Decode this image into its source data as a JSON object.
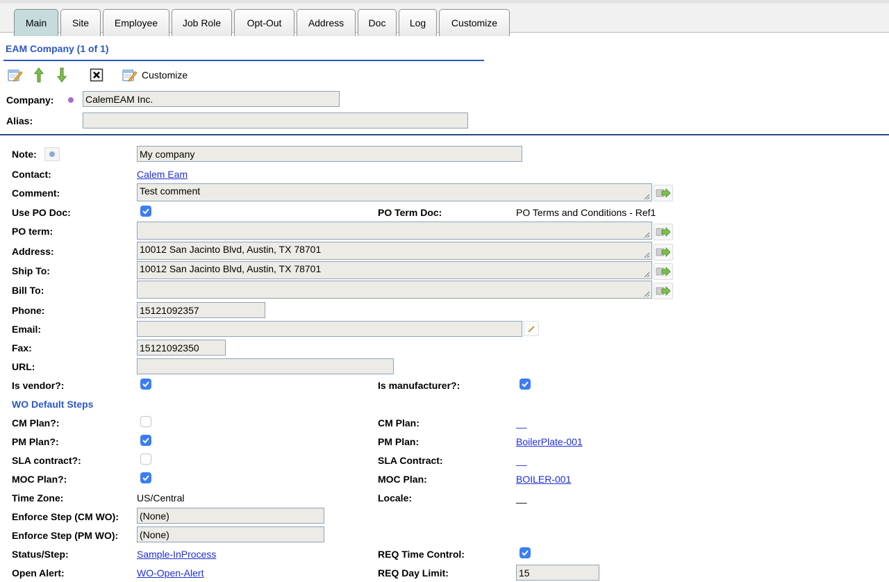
{
  "tabs": [
    {
      "label": "Main",
      "active": true
    },
    {
      "label": "Site"
    },
    {
      "label": "Employee"
    },
    {
      "label": "Job Role"
    },
    {
      "label": "Opt-Out"
    },
    {
      "label": "Address"
    },
    {
      "label": "Doc"
    },
    {
      "label": "Log"
    },
    {
      "label": "Customize"
    }
  ],
  "header": {
    "title": "EAM Company (1 of 1)",
    "customize_label": "Customize",
    "company_label": "Company:",
    "company_value": "CalemEAM Inc.",
    "alias_label": "Alias:",
    "alias_value": ""
  },
  "form": {
    "note": {
      "label": "Note:",
      "value": "My company"
    },
    "contact": {
      "label": "Contact:",
      "value": "Calem Eam"
    },
    "comment": {
      "label": "Comment:",
      "value": "Test comment"
    },
    "use_po_doc": {
      "label": "Use PO Doc:",
      "checked": true
    },
    "po_term_doc": {
      "label": "PO Term Doc:",
      "value": "PO Terms and Conditions - Ref1"
    },
    "po_term": {
      "label": "PO term:",
      "value": ""
    },
    "address": {
      "label": "Address:",
      "value": "10012 San Jacinto Blvd, Austin, TX 78701"
    },
    "ship_to": {
      "label": "Ship To:",
      "value": "10012 San Jacinto Blvd, Austin, TX 78701"
    },
    "bill_to": {
      "label": "Bill To:",
      "value": ""
    },
    "phone": {
      "label": "Phone:",
      "value": "15121092357"
    },
    "email": {
      "label": "Email:",
      "value": ""
    },
    "fax": {
      "label": "Fax:",
      "value": "15121092350"
    },
    "url": {
      "label": "URL:",
      "value": ""
    },
    "is_vendor": {
      "label": "Is vendor?:",
      "checked": true
    },
    "is_manufacturer": {
      "label": "Is manufacturer?:",
      "checked": true
    },
    "wo_section_title": "WO Default Steps",
    "cm_plan_flag": {
      "label": "CM Plan?:",
      "checked": false
    },
    "cm_plan": {
      "label": "CM Plan:",
      "value": "__"
    },
    "pm_plan_flag": {
      "label": "PM Plan?:",
      "checked": true
    },
    "pm_plan": {
      "label": "PM Plan:",
      "value": "BoilerPlate-001"
    },
    "sla_flag": {
      "label": "SLA contract?:",
      "checked": false
    },
    "sla_contract": {
      "label": "SLA Contract:",
      "value": "__"
    },
    "moc_flag": {
      "label": "MOC Plan?:",
      "checked": true
    },
    "moc_plan": {
      "label": "MOC Plan:",
      "value": "BOILER-001"
    },
    "time_zone": {
      "label": "Time Zone:",
      "value": "US/Central"
    },
    "locale": {
      "label": "Locale:",
      "value": "__"
    },
    "enforce_cm": {
      "label": "Enforce Step (CM WO):",
      "value": "(None)"
    },
    "enforce_pm": {
      "label": "Enforce Step (PM WO):",
      "value": "(None)"
    },
    "status_step": {
      "label": "Status/Step:",
      "value": "Sample-InProcess"
    },
    "req_time_control": {
      "label": "REQ Time Control:",
      "checked": true
    },
    "open_alert": {
      "label": "Open Alert:",
      "value": "WO-Open-Alert"
    },
    "req_day_limit": {
      "label": "REQ Day Limit:",
      "value": "15"
    }
  },
  "colors": {
    "accent_blue": "#2a57c6",
    "link_blue": "#1d2ed8",
    "checkbox_blue": "#3b7ef4",
    "field_bg": "#ecebe6",
    "active_tab": "#c6dbdc"
  }
}
